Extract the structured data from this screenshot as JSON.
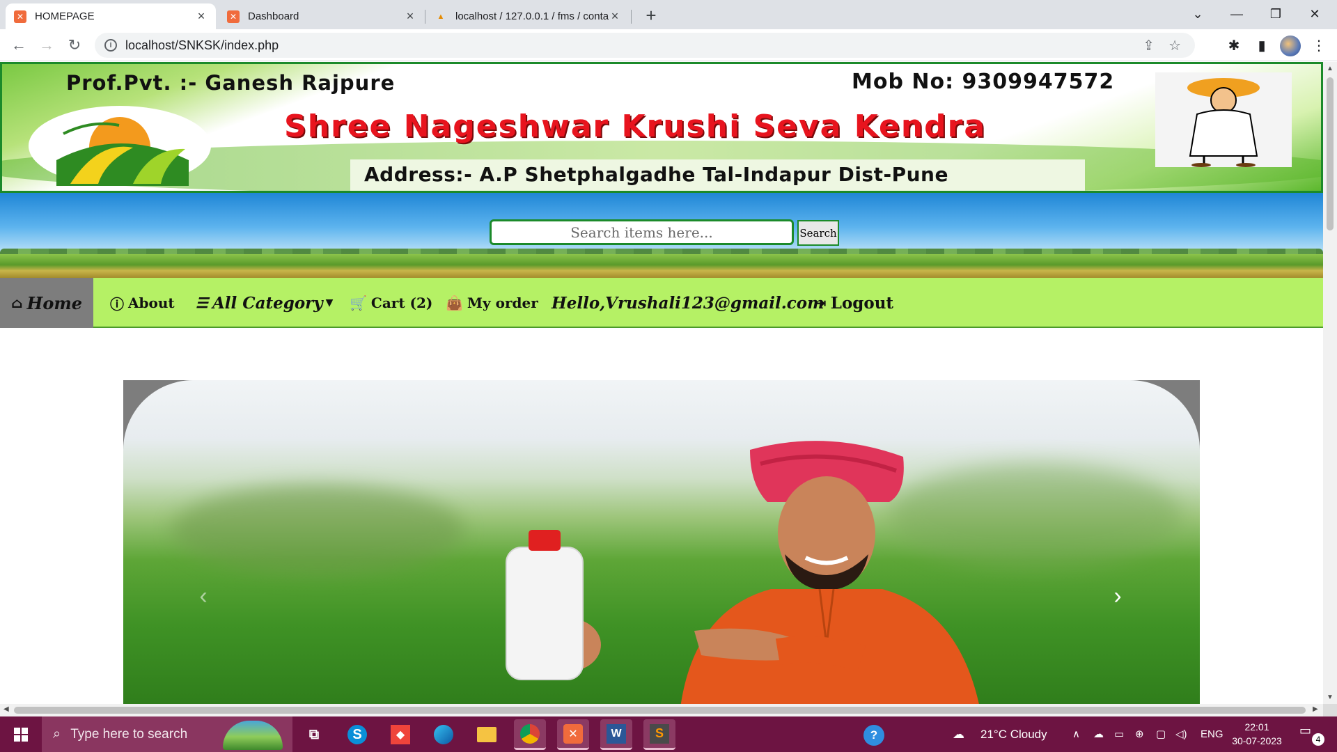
{
  "browser": {
    "tabs": [
      {
        "title": "HOMEPAGE",
        "icon": "xampp-icon",
        "active": true
      },
      {
        "title": "Dashboard",
        "icon": "xampp-icon",
        "active": false
      },
      {
        "title": "localhost / 127.0.0.1 / fms / conta",
        "icon": "phpmyadmin-icon",
        "active": false
      }
    ],
    "url": "localhost/SNKSK/index.php"
  },
  "banner": {
    "proprietor": "Prof.Pvt. :-  Ganesh Rajpure",
    "mobile": "Mob No: 9309947572",
    "shop_name": "Shree Nageshwar Krushi Seva Kendra",
    "address": "Address:- A.P Shetphalgadhe Tal-Indapur Dist-Pune"
  },
  "search": {
    "placeholder": "Search items here...",
    "button_label": "Search"
  },
  "nav": {
    "home": "Home",
    "about": "About",
    "all_category": "All Category",
    "cart": "Cart (2)",
    "my_order": "My order",
    "hello": "Hello,Vrushali123@gmail.com",
    "logout": "Logout"
  },
  "taskbar": {
    "search_placeholder": "Type here to search",
    "weather": "21°C  Cloudy",
    "language": "ENG",
    "time": "22:01",
    "date": "30-07-2023",
    "notifications": "4"
  },
  "colors": {
    "nav_bg": "#b5f165",
    "home_active_bg": "#7d7d7d",
    "shop_name": "#e8141e",
    "taskbar": "#6d1442"
  }
}
